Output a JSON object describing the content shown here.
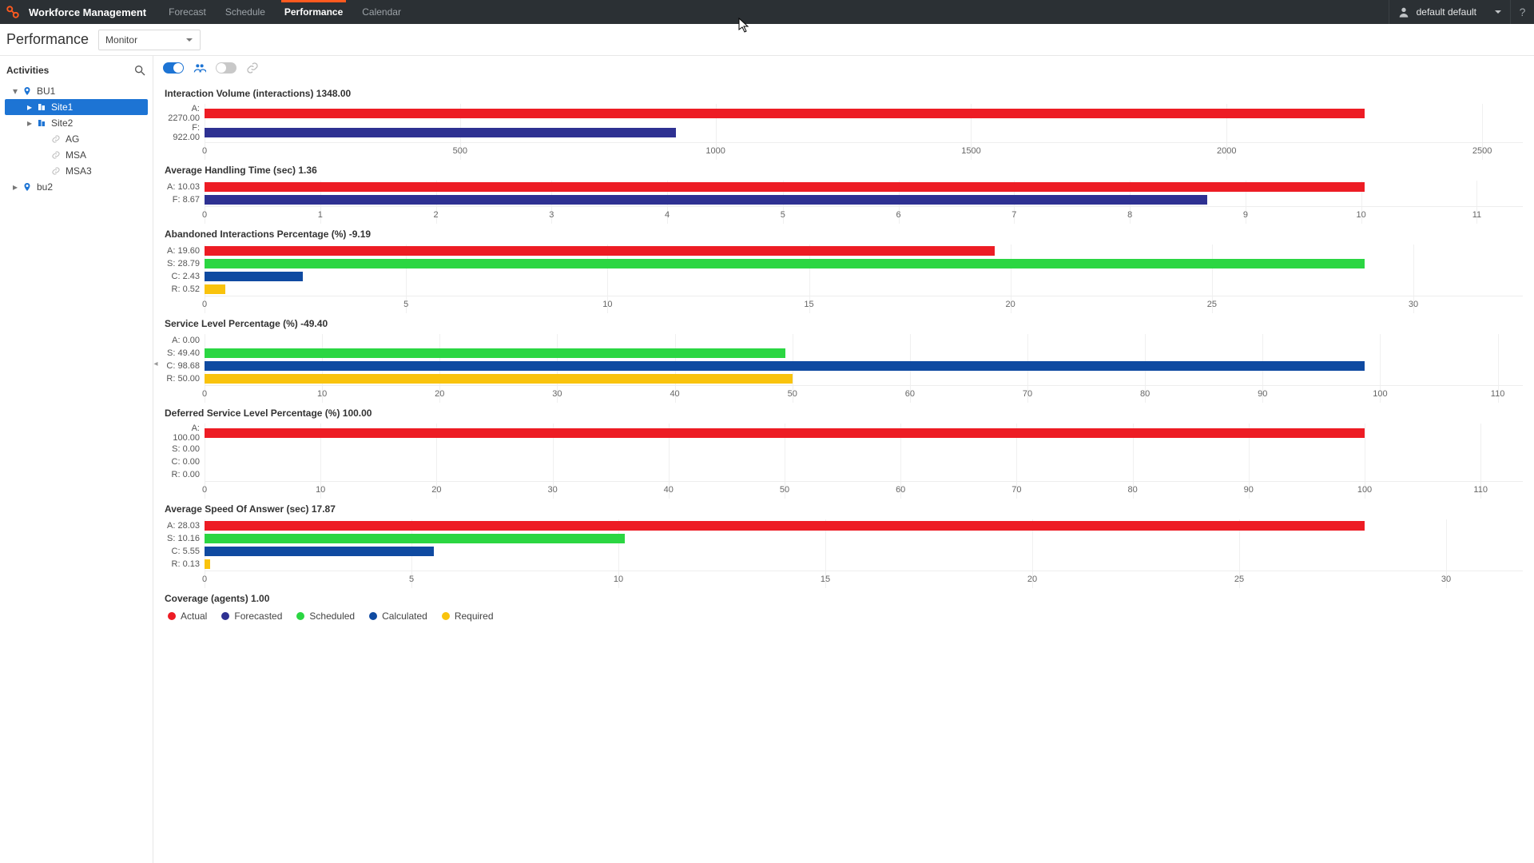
{
  "app": {
    "name": "Workforce Management"
  },
  "nav": {
    "items": [
      "Forecast",
      "Schedule",
      "Performance",
      "Calendar"
    ],
    "active": 2
  },
  "user": {
    "name": "default default"
  },
  "page": {
    "title": "Performance",
    "mode_selected": "Monitor"
  },
  "sidebar": {
    "title": "Activities",
    "tree": [
      {
        "label": "BU1",
        "level": 0,
        "expandable": true,
        "expanded": true,
        "icon": "pin",
        "selected": false
      },
      {
        "label": "Site1",
        "level": 1,
        "expandable": true,
        "expanded": false,
        "icon": "site",
        "selected": true
      },
      {
        "label": "Site2",
        "level": 1,
        "expandable": true,
        "expanded": false,
        "icon": "site",
        "selected": false
      },
      {
        "label": "AG",
        "level": 2,
        "expandable": false,
        "icon": "link",
        "selected": false
      },
      {
        "label": "MSA",
        "level": 2,
        "expandable": false,
        "icon": "link",
        "selected": false
      },
      {
        "label": "MSA3",
        "level": 2,
        "expandable": false,
        "icon": "link",
        "selected": false
      },
      {
        "label": "bu2",
        "level": 0,
        "expandable": true,
        "expanded": false,
        "icon": "pin",
        "selected": false
      }
    ]
  },
  "legend": {
    "actual": "Actual",
    "forecasted": "Forecasted",
    "scheduled": "Scheduled",
    "calculated": "Calculated",
    "required": "Required"
  },
  "coverage_title": "Coverage (agents) 1.00",
  "chart_data": [
    {
      "type": "bar",
      "title": "Interaction Volume (interactions) 1348.00",
      "series": [
        {
          "name": "A",
          "label": "A: 2270.00",
          "value": 2270.0,
          "kind": "A"
        },
        {
          "name": "F",
          "label": "F: 922.00",
          "value": 922.0,
          "kind": "F"
        }
      ],
      "ticks": [
        0,
        500,
        1000,
        1500,
        2000,
        2500
      ],
      "xmax": 2500,
      "barmax": 2270.0
    },
    {
      "type": "bar",
      "title": "Average Handling Time (sec) 1.36",
      "series": [
        {
          "name": "A",
          "label": "A: 10.03",
          "value": 10.03,
          "kind": "A"
        },
        {
          "name": "F",
          "label": "F: 8.67",
          "value": 8.67,
          "kind": "F"
        }
      ],
      "ticks": [
        0,
        1,
        2,
        3,
        4,
        5,
        6,
        7,
        8,
        9,
        10,
        11
      ],
      "xmax": 11,
      "barmax": 10.03
    },
    {
      "type": "bar",
      "title": "Abandoned Interactions Percentage (%) -9.19",
      "series": [
        {
          "name": "A",
          "label": "A: 19.60",
          "value": 19.6,
          "kind": "A"
        },
        {
          "name": "S",
          "label": "S: 28.79",
          "value": 28.79,
          "kind": "S"
        },
        {
          "name": "C",
          "label": "C: 2.43",
          "value": 2.43,
          "kind": "C"
        },
        {
          "name": "R",
          "label": "R: 0.52",
          "value": 0.52,
          "kind": "R"
        }
      ],
      "ticks": [
        0,
        5,
        10,
        15,
        20,
        25,
        30
      ],
      "xmax": 30,
      "barmax": 28.79
    },
    {
      "type": "bar",
      "title": "Service Level Percentage (%) -49.40",
      "series": [
        {
          "name": "A",
          "label": "A: 0.00",
          "value": 0.0,
          "kind": "A"
        },
        {
          "name": "S",
          "label": "S: 49.40",
          "value": 49.4,
          "kind": "S"
        },
        {
          "name": "C",
          "label": "C: 98.68",
          "value": 98.68,
          "kind": "C"
        },
        {
          "name": "R",
          "label": "R: 50.00",
          "value": 50.0,
          "kind": "R"
        }
      ],
      "ticks": [
        0,
        10,
        20,
        30,
        40,
        50,
        60,
        70,
        80,
        90,
        100,
        110
      ],
      "xmax": 110,
      "barmax": 98.68
    },
    {
      "type": "bar",
      "title": "Deferred Service Level Percentage (%) 100.00",
      "series": [
        {
          "name": "A",
          "label": "A: 100.00",
          "value": 100.0,
          "kind": "A"
        },
        {
          "name": "S",
          "label": "S: 0.00",
          "value": 0.0,
          "kind": "S"
        },
        {
          "name": "C",
          "label": "C: 0.00",
          "value": 0.0,
          "kind": "C"
        },
        {
          "name": "R",
          "label": "R: 0.00",
          "value": 0.0,
          "kind": "R"
        }
      ],
      "ticks": [
        0,
        10,
        20,
        30,
        40,
        50,
        60,
        70,
        80,
        90,
        100,
        110
      ],
      "xmax": 110,
      "barmax": 100.0
    },
    {
      "type": "bar",
      "title": "Average Speed Of Answer (sec) 17.87",
      "series": [
        {
          "name": "A",
          "label": "A: 28.03",
          "value": 28.03,
          "kind": "A"
        },
        {
          "name": "S",
          "label": "S: 10.16",
          "value": 10.16,
          "kind": "S"
        },
        {
          "name": "C",
          "label": "C: 5.55",
          "value": 5.55,
          "kind": "C"
        },
        {
          "name": "R",
          "label": "R: 0.13",
          "value": 0.13,
          "kind": "R"
        }
      ],
      "ticks": [
        0,
        5,
        10,
        15,
        20,
        25,
        30
      ],
      "xmax": 30,
      "barmax": 28.03
    }
  ]
}
